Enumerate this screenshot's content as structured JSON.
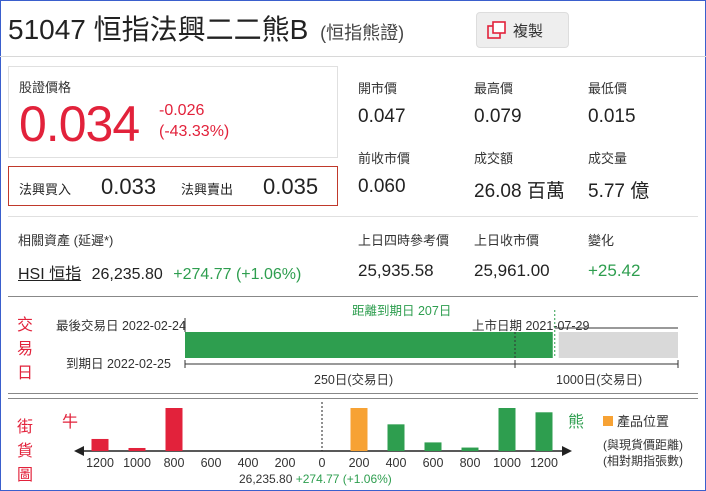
{
  "header": {
    "code": "51047",
    "name": "恒指法興二二熊B",
    "subtitle": "(恒指熊證)",
    "copy_label": "複製"
  },
  "quote": {
    "price_label": "股證價格",
    "price": "0.034",
    "change": "-0.026",
    "change_pct": "(-43.33%)",
    "bid_label": "法興買入",
    "bid": "0.033",
    "ask_label": "法興賣出",
    "ask": "0.035"
  },
  "stats": [
    {
      "label": "開市價",
      "value": "0.047"
    },
    {
      "label": "最高價",
      "value": "0.079"
    },
    {
      "label": "最低價",
      "value": "0.015"
    },
    {
      "label": "前收市價",
      "value": "0.060"
    },
    {
      "label": "成交額",
      "value": "26.08 百萬"
    },
    {
      "label": "成交量",
      "value": "5.77 億"
    }
  ],
  "underlying": {
    "label": "相關資產 (延遲*)",
    "name": "HSI 恒指",
    "price": "26,235.80",
    "change": "+274.77 (+1.06%)",
    "ref_label": "上日四時參考價",
    "ref_value": "25,935.58",
    "close_label": "上日收市價",
    "close_value": "25,961.00",
    "diff_label": "變化",
    "diff_value": "+25.42"
  },
  "trading": {
    "section_label": [
      "交",
      "易",
      "日"
    ],
    "last_trade": "最後交易日 2022-02-24",
    "expiry": "到期日 2022-02-25",
    "to_expiry": "距離到期日 207日",
    "listing": "上市日期 2021-07-29",
    "remaining_days": "250日(交易日)",
    "total_days": "1000日(交易日)",
    "elapsed_fraction": 0.75,
    "colors": {
      "remaining": "#2e9e4f",
      "elapsed": "#d9d9d9"
    }
  },
  "street": {
    "section_label": [
      "街",
      "貨",
      "圖"
    ],
    "bull_label": "牛",
    "bear_label": "熊",
    "legend_label": "產品位置",
    "note_line1": "(與現貨價距離)",
    "note_line2": "(相對期指張數)",
    "center_price": "26,235.80",
    "center_change": "+274.77 (+1.06%)",
    "ticks": [
      "1200",
      "1000",
      "800",
      "600",
      "400",
      "200",
      "0",
      "200",
      "400",
      "600",
      "800",
      "1000",
      "1200"
    ],
    "colors": {
      "bull": "#e2223b",
      "bear": "#2e9e4f",
      "product": "#f7a234"
    },
    "bars": [
      {
        "position": -1200,
        "side": "bull",
        "level": 0.28
      },
      {
        "position": -1000,
        "side": "bull",
        "level": 0.07
      },
      {
        "position": -800,
        "side": "bull",
        "level": 1.0
      },
      {
        "position": 200,
        "side": "product",
        "level": 1.0
      },
      {
        "position": 400,
        "side": "bear",
        "level": 0.62
      },
      {
        "position": 600,
        "side": "bear",
        "level": 0.2
      },
      {
        "position": 800,
        "side": "bear",
        "level": 0.08
      },
      {
        "position": 1000,
        "side": "bear",
        "level": 1.0
      },
      {
        "position": 1200,
        "side": "bear",
        "level": 0.9
      }
    ]
  }
}
